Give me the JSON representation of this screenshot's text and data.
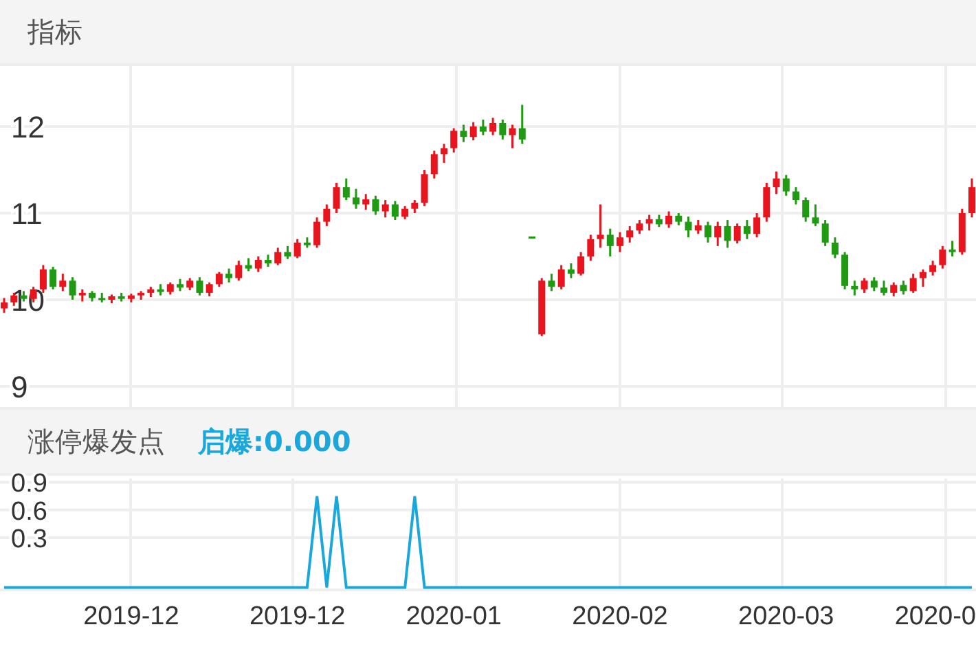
{
  "indicator_header": {
    "title": "指标"
  },
  "price_chart": {
    "chart_data": {
      "type": "candlestick",
      "grid": true,
      "ylim": [
        8.73,
        12.73
      ],
      "yticks": [
        12,
        11,
        10,
        9
      ],
      "categories": [
        null,
        null,
        null,
        null,
        null,
        null,
        null,
        null,
        null,
        null,
        null,
        null,
        null,
        null,
        null,
        null,
        null,
        null,
        null,
        null,
        null,
        null,
        null,
        null,
        null,
        null,
        null,
        null,
        null,
        null,
        null,
        null,
        null,
        null,
        null,
        null,
        null,
        null,
        null,
        null,
        null,
        null,
        null,
        null,
        null,
        null,
        null,
        null,
        null,
        null,
        null,
        null,
        null,
        null,
        null,
        null,
        null,
        null,
        null,
        null,
        null,
        null,
        null,
        null,
        null,
        null,
        null,
        null,
        null,
        null,
        null,
        null,
        null,
        null,
        null,
        null,
        null,
        null,
        null,
        null,
        null,
        null,
        null,
        null,
        null,
        null,
        null,
        null,
        null,
        null,
        null,
        null,
        null,
        null,
        null,
        null,
        null,
        null,
        null,
        null
      ],
      "ohlc": [
        [
          9.9,
          10.02,
          9.85,
          9.97
        ],
        [
          9.97,
          10.08,
          9.93,
          10.05
        ],
        [
          10.05,
          10.1,
          9.98,
          10.01
        ],
        [
          10.01,
          10.15,
          9.97,
          10.12
        ],
        [
          10.12,
          10.4,
          10.08,
          10.35
        ],
        [
          10.35,
          10.38,
          10.12,
          10.15
        ],
        [
          10.15,
          10.3,
          10.1,
          10.22
        ],
        [
          10.22,
          10.26,
          10.0,
          10.05
        ],
        [
          10.05,
          10.12,
          9.98,
          10.08
        ],
        [
          10.08,
          10.1,
          9.98,
          10.02
        ],
        [
          10.02,
          10.08,
          9.97,
          10.0
        ],
        [
          10.0,
          10.06,
          9.96,
          10.04
        ],
        [
          10.04,
          10.08,
          9.98,
          10.01
        ],
        [
          10.01,
          10.07,
          9.97,
          10.05
        ],
        [
          10.05,
          10.1,
          10.0,
          10.08
        ],
        [
          10.08,
          10.15,
          10.03,
          10.12
        ],
        [
          10.12,
          10.18,
          10.05,
          10.09
        ],
        [
          10.09,
          10.2,
          10.06,
          10.18
        ],
        [
          10.18,
          10.24,
          10.1,
          10.14
        ],
        [
          10.14,
          10.25,
          10.11,
          10.22
        ],
        [
          10.22,
          10.26,
          10.05,
          10.08
        ],
        [
          10.08,
          10.2,
          10.04,
          10.18
        ],
        [
          10.18,
          10.32,
          10.15,
          10.3
        ],
        [
          10.3,
          10.36,
          10.2,
          10.25
        ],
        [
          10.25,
          10.45,
          10.22,
          10.4
        ],
        [
          10.4,
          10.48,
          10.33,
          10.36
        ],
        [
          10.36,
          10.5,
          10.32,
          10.46
        ],
        [
          10.46,
          10.52,
          10.38,
          10.42
        ],
        [
          10.42,
          10.6,
          10.4,
          10.55
        ],
        [
          10.55,
          10.62,
          10.47,
          10.5
        ],
        [
          10.5,
          10.7,
          10.48,
          10.66
        ],
        [
          10.66,
          10.72,
          10.6,
          10.63
        ],
        [
          10.63,
          10.95,
          10.6,
          10.9
        ],
        [
          10.9,
          11.1,
          10.85,
          11.05
        ],
        [
          11.05,
          11.35,
          11.0,
          11.3
        ],
        [
          11.3,
          11.4,
          11.15,
          11.18
        ],
        [
          11.18,
          11.28,
          11.05,
          11.1
        ],
        [
          11.1,
          11.22,
          11.04,
          11.16
        ],
        [
          11.16,
          11.2,
          10.98,
          11.02
        ],
        [
          11.02,
          11.15,
          10.95,
          11.1
        ],
        [
          11.1,
          11.14,
          10.92,
          10.96
        ],
        [
          10.96,
          11.08,
          10.93,
          11.05
        ],
        [
          11.05,
          11.15,
          11.0,
          11.12
        ],
        [
          11.12,
          11.5,
          11.08,
          11.45
        ],
        [
          11.45,
          11.72,
          11.4,
          11.68
        ],
        [
          11.68,
          11.8,
          11.58,
          11.75
        ],
        [
          11.75,
          11.98,
          11.7,
          11.95
        ],
        [
          11.95,
          12.02,
          11.82,
          11.88
        ],
        [
          11.88,
          12.05,
          11.84,
          12.0
        ],
        [
          12.0,
          12.08,
          11.9,
          11.94
        ],
        [
          11.94,
          12.1,
          11.9,
          12.04
        ],
        [
          12.04,
          12.08,
          11.85,
          11.9
        ],
        [
          11.9,
          12.02,
          11.75,
          11.98
        ],
        [
          11.98,
          12.25,
          11.8,
          11.85
        ],
        [
          10.73,
          10.73,
          10.72,
          10.72
        ],
        [
          9.6,
          10.25,
          9.58,
          10.22
        ],
        [
          10.22,
          10.3,
          10.1,
          10.15
        ],
        [
          10.15,
          10.4,
          10.12,
          10.35
        ],
        [
          10.35,
          10.42,
          10.25,
          10.3
        ],
        [
          10.3,
          10.55,
          10.28,
          10.5
        ],
        [
          10.5,
          10.75,
          10.45,
          10.7
        ],
        [
          10.7,
          11.1,
          10.6,
          10.75
        ],
        [
          10.75,
          10.82,
          10.5,
          10.62
        ],
        [
          10.62,
          10.78,
          10.55,
          10.72
        ],
        [
          10.72,
          10.85,
          10.66,
          10.8
        ],
        [
          10.8,
          10.92,
          10.76,
          10.88
        ],
        [
          10.88,
          10.98,
          10.8,
          10.93
        ],
        [
          10.93,
          10.98,
          10.84,
          10.87
        ],
        [
          10.87,
          11.02,
          10.83,
          10.97
        ],
        [
          10.97,
          11.0,
          10.86,
          10.9
        ],
        [
          10.9,
          10.96,
          10.72,
          10.8
        ],
        [
          10.8,
          10.92,
          10.76,
          10.86
        ],
        [
          10.86,
          10.9,
          10.66,
          10.72
        ],
        [
          10.72,
          10.9,
          10.62,
          10.85
        ],
        [
          10.85,
          10.92,
          10.6,
          10.68
        ],
        [
          10.68,
          10.88,
          10.65,
          10.85
        ],
        [
          10.85,
          10.92,
          10.7,
          10.76
        ],
        [
          10.76,
          11.0,
          10.72,
          10.95
        ],
        [
          10.95,
          11.35,
          10.9,
          11.3
        ],
        [
          11.3,
          11.48,
          11.22,
          11.4
        ],
        [
          11.4,
          11.44,
          11.2,
          11.25
        ],
        [
          11.25,
          11.3,
          11.1,
          11.15
        ],
        [
          11.15,
          11.18,
          10.9,
          10.95
        ],
        [
          10.95,
          11.1,
          10.85,
          10.88
        ],
        [
          10.88,
          10.92,
          10.62,
          10.66
        ],
        [
          10.66,
          10.72,
          10.48,
          10.52
        ],
        [
          10.52,
          10.55,
          10.12,
          10.16
        ],
        [
          10.16,
          10.22,
          10.05,
          10.12
        ],
        [
          10.12,
          10.25,
          10.08,
          10.22
        ],
        [
          10.22,
          10.26,
          10.1,
          10.14
        ],
        [
          10.14,
          10.22,
          10.05,
          10.08
        ],
        [
          10.08,
          10.2,
          10.04,
          10.17
        ],
        [
          10.17,
          10.22,
          10.06,
          10.1
        ],
        [
          10.1,
          10.3,
          10.08,
          10.25
        ],
        [
          10.25,
          10.35,
          10.15,
          10.32
        ],
        [
          10.32,
          10.45,
          10.28,
          10.4
        ],
        [
          10.4,
          10.62,
          10.36,
          10.58
        ],
        [
          10.58,
          10.68,
          10.5,
          10.55
        ],
        [
          10.55,
          11.05,
          10.52,
          11.0
        ],
        [
          11.0,
          11.4,
          10.95,
          11.3
        ]
      ]
    }
  },
  "signal_header": {
    "title": "涨停爆发点",
    "reading": "启爆:0.000"
  },
  "signal_chart": {
    "chart_data": {
      "type": "line",
      "grid": true,
      "categories": [
        null,
        null,
        null,
        null,
        null,
        null,
        null,
        null,
        null,
        null,
        null,
        null,
        null,
        "2019-12",
        null,
        null,
        null,
        null,
        null,
        null,
        null,
        null,
        null,
        null,
        null,
        null,
        null,
        null,
        null,
        null,
        "2019-12",
        null,
        null,
        null,
        null,
        null,
        null,
        null,
        null,
        null,
        null,
        null,
        null,
        null,
        null,
        null,
        "2020-01",
        null,
        null,
        null,
        null,
        null,
        null,
        null,
        null,
        null,
        null,
        null,
        null,
        null,
        null,
        null,
        null,
        "2020-02",
        null,
        null,
        null,
        null,
        null,
        null,
        null,
        null,
        null,
        null,
        null,
        null,
        null,
        null,
        null,
        null,
        "2020-03",
        null,
        null,
        null,
        null,
        null,
        null,
        null,
        null,
        null,
        null,
        null,
        null,
        null,
        null,
        null,
        "2020-0",
        null,
        null,
        null
      ],
      "series": [
        {
          "color": "#1aa8dc",
          "values": [
            -0.24,
            -0.24,
            -0.24,
            -0.24,
            -0.24,
            -0.24,
            -0.24,
            -0.24,
            -0.24,
            -0.24,
            -0.24,
            -0.24,
            -0.24,
            -0.24,
            -0.24,
            -0.24,
            -0.24,
            -0.24,
            -0.24,
            -0.24,
            -0.24,
            -0.24,
            -0.24,
            -0.24,
            -0.24,
            -0.24,
            -0.24,
            -0.24,
            -0.24,
            -0.24,
            -0.24,
            -0.24,
            0.75,
            -0.24,
            0.75,
            -0.24,
            -0.24,
            -0.24,
            -0.24,
            -0.24,
            -0.24,
            -0.24,
            0.75,
            -0.24,
            -0.24,
            -0.24,
            -0.24,
            -0.24,
            -0.24,
            -0.24,
            -0.24,
            -0.24,
            -0.24,
            -0.24,
            -0.24,
            -0.24,
            -0.24,
            -0.24,
            -0.24,
            -0.24,
            -0.24,
            -0.24,
            -0.24,
            -0.24,
            -0.24,
            -0.24,
            -0.24,
            -0.24,
            -0.24,
            -0.24,
            -0.24,
            -0.24,
            -0.24,
            -0.24,
            -0.24,
            -0.24,
            -0.24,
            -0.24,
            -0.24,
            -0.24,
            -0.24,
            -0.24,
            -0.24,
            -0.24,
            -0.24,
            -0.24,
            -0.24,
            -0.24,
            -0.24,
            -0.24,
            -0.24,
            -0.24,
            -0.24,
            -0.24,
            -0.24,
            -0.24,
            -0.24,
            -0.24,
            -0.24,
            -0.24
          ]
        }
      ],
      "ylim": [
        -0.28,
        1.0
      ],
      "yticks": [
        0.3,
        0.6,
        0.9
      ]
    }
  }
}
